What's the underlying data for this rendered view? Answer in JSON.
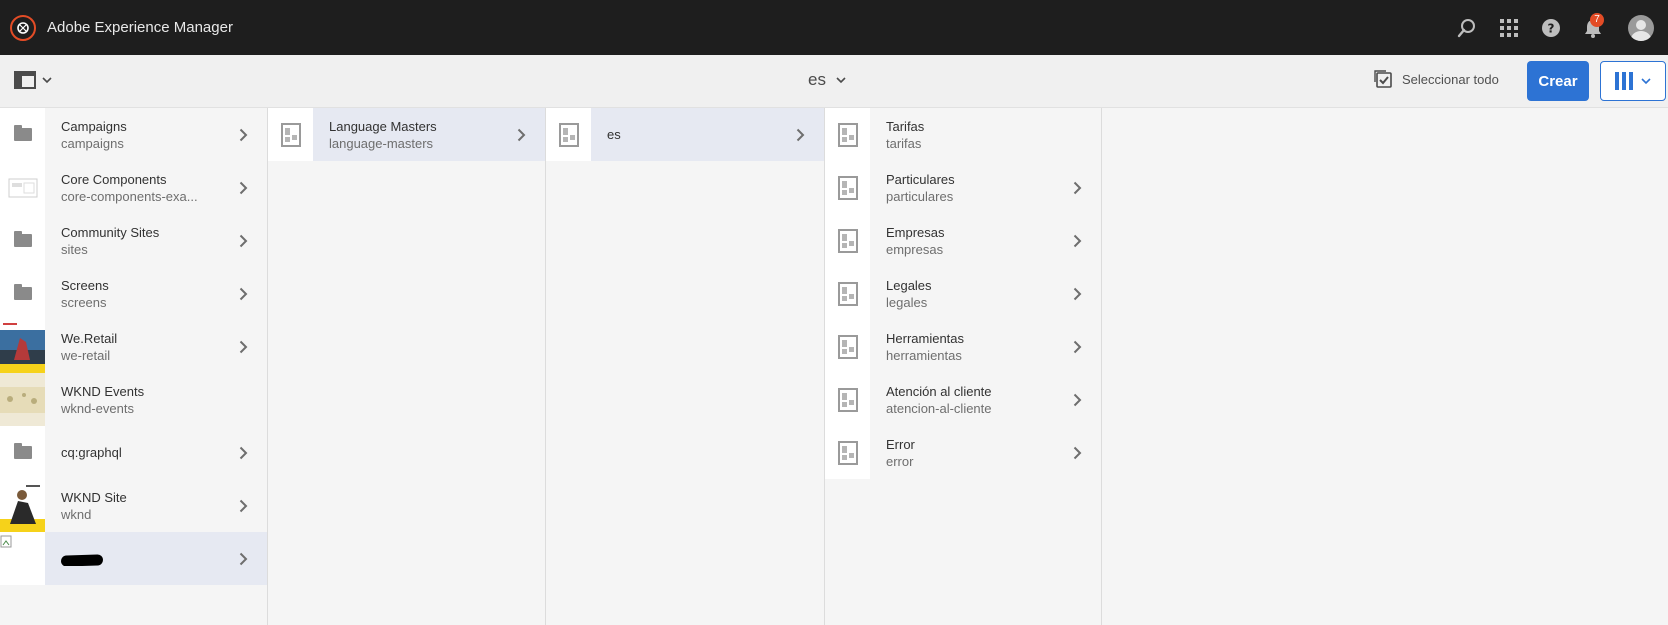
{
  "header": {
    "app_title": "Adobe Experience Manager",
    "notifications_count": "7",
    "icons": [
      "search-icon",
      "apps-grid-icon",
      "help-icon",
      "bell-icon",
      "avatar"
    ]
  },
  "actionbar": {
    "location": "es",
    "select_all_label": "Seleccionar todo",
    "create_label": "Crear"
  },
  "colors": {
    "accent": "#2d73d4",
    "header_bg": "#1e1e1e",
    "selected_row": "#e6e9f2",
    "badge": "#e34c26"
  },
  "columns": [
    {
      "items": [
        {
          "title": "Campaigns",
          "subtitle": "campaigns",
          "icon": "folder-icon",
          "has_children": true,
          "selected": false
        },
        {
          "title": "Core Components",
          "subtitle": "core-components-exa...",
          "icon": "template-thumb",
          "has_children": true,
          "selected": false
        },
        {
          "title": "Community Sites",
          "subtitle": "sites",
          "icon": "folder-icon",
          "has_children": true,
          "selected": false
        },
        {
          "title": "Screens",
          "subtitle": "screens",
          "icon": "folder-icon",
          "has_children": true,
          "selected": false
        },
        {
          "title": "We.Retail",
          "subtitle": "we-retail",
          "icon": "we-retail-thumb",
          "has_children": true,
          "selected": false
        },
        {
          "title": "WKND Events",
          "subtitle": "wknd-events",
          "icon": "wknd-events-thumb",
          "has_children": false,
          "selected": false
        },
        {
          "title": "cq:graphql",
          "subtitle": "",
          "icon": "folder-icon",
          "has_children": true,
          "selected": false
        },
        {
          "title": "WKND Site",
          "subtitle": "wknd",
          "icon": "wknd-thumb",
          "has_children": true,
          "selected": false
        },
        {
          "title": "",
          "subtitle": "",
          "icon": "broken-image-icon",
          "has_children": true,
          "selected": true,
          "redacted": true
        }
      ]
    },
    {
      "items": [
        {
          "title": "Language Masters",
          "subtitle": "language-masters",
          "icon": "page-icon",
          "has_children": true,
          "selected": true
        }
      ]
    },
    {
      "items": [
        {
          "title": "es",
          "subtitle": "",
          "icon": "page-icon",
          "has_children": true,
          "selected": true
        }
      ]
    },
    {
      "items": [
        {
          "title": "Tarifas",
          "subtitle": "tarifas",
          "icon": "page-icon",
          "has_children": false,
          "selected": false
        },
        {
          "title": "Particulares",
          "subtitle": "particulares",
          "icon": "page-icon",
          "has_children": true,
          "selected": false
        },
        {
          "title": "Empresas",
          "subtitle": "empresas",
          "icon": "page-icon",
          "has_children": true,
          "selected": false
        },
        {
          "title": "Legales",
          "subtitle": "legales",
          "icon": "page-icon",
          "has_children": true,
          "selected": false
        },
        {
          "title": "Herramientas",
          "subtitle": "herramientas",
          "icon": "page-icon",
          "has_children": true,
          "selected": false
        },
        {
          "title": "Atención al cliente",
          "subtitle": "atencion-al-cliente",
          "icon": "page-icon",
          "has_children": true,
          "selected": false
        },
        {
          "title": "Error",
          "subtitle": "error",
          "icon": "page-icon",
          "has_children": true,
          "selected": false
        }
      ]
    },
    {
      "items": []
    }
  ]
}
